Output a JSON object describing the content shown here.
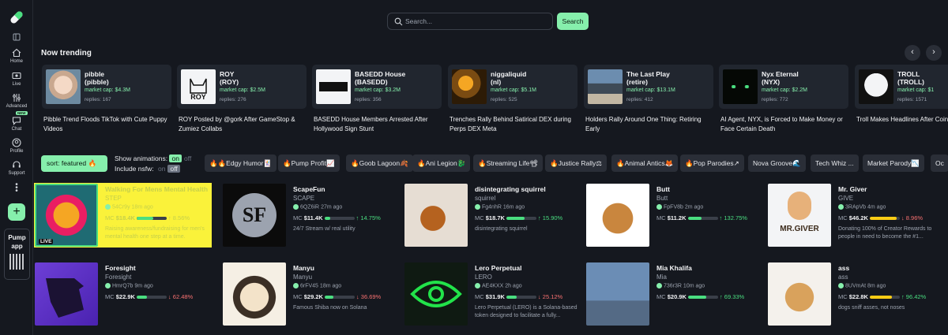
{
  "sidebar": {
    "items": [
      {
        "label": "Home",
        "icon": "home-icon"
      },
      {
        "label": "Live",
        "icon": "live-icon"
      },
      {
        "label": "Advanced",
        "icon": "advanced-icon"
      },
      {
        "label": "Chat",
        "icon": "chat-icon",
        "badge": "NEW"
      },
      {
        "label": "Profile",
        "icon": "profile-icon"
      },
      {
        "label": "Support",
        "icon": "support-icon"
      }
    ],
    "app_card": {
      "line1": "Pump",
      "line2": "app"
    }
  },
  "search": {
    "placeholder": "Search...",
    "button": "Search"
  },
  "trending": {
    "title": "Now trending",
    "cards": [
      {
        "name": "pibble",
        "ticker": "(pibble)",
        "mcap": "market cap: $4.3M",
        "replies": "replies: 167",
        "headline": "Pibble Trend Floods TikTok with Cute Puppy Videos"
      },
      {
        "name": "ROY",
        "ticker": "(ROY)",
        "mcap": "market cap: $2.5M",
        "replies": "replies: 276",
        "headline": "ROY Posted by @gork After GameStop & Zumiez Collabs"
      },
      {
        "name": "BASEDD House",
        "ticker": "(BASEDD)",
        "mcap": "market cap: $3.2M",
        "replies": "replies: 356",
        "headline": "BASEDD House Members Arrested After Hollywood Sign Stunt"
      },
      {
        "name": "niggaliquid",
        "ticker": "(nl)",
        "mcap": "market cap: $5.1M",
        "replies": "replies: 525",
        "headline": "Trenches Rally Behind Satirical DEX during Perps DEX Meta"
      },
      {
        "name": "The Last Play",
        "ticker": "(retire)",
        "mcap": "market cap: $13.1M",
        "replies": "replies: 412",
        "headline": "Holders Rally Around One Thing: Retiring Early"
      },
      {
        "name": "Nyx Eternal",
        "ticker": "(NYX)",
        "mcap": "market cap: $2.2M",
        "replies": "replies: 772",
        "headline": "AI Agent, NYX, is Forced to Make Money or Face Certain Death"
      },
      {
        "name": "TROLL",
        "ticker": "(TROLL)",
        "mcap": "market cap: $1",
        "replies": "replies: 1571",
        "headline": "Troll Makes Headlines After Coinbase Listing"
      }
    ]
  },
  "filters": {
    "sort": "sort: featured 🔥",
    "animations_label": "Show animations:",
    "nsfw_label": "Include nsfw:",
    "on": "on",
    "off": "off",
    "chips": [
      "🔥🔥Edgy Humor🃏",
      "🔥Pump Profit📈",
      "🔥Goob Lagoon🍂",
      "🔥Ani Legion🐉",
      "🔥Streaming Life📽",
      "🔥Justice Rally⚖",
      "🔥Animal Antics🦊",
      "🔥Pop Parodies↗",
      "Nova Groove🌊",
      "Tech Whiz ...",
      "Market Parody📉",
      "Oc"
    ]
  },
  "coins": [
    {
      "name": "Walking For Mens Mental Health",
      "symbol": "STEP",
      "dev": "54Cr9y",
      "age": "18m ago",
      "mc": "$18.4K",
      "change": "↑ 8.56%",
      "dir": "up",
      "progress": 0.55,
      "desc": "Raising awareness/fundraising for men's mental health one step at a time.",
      "highlight": true,
      "live": "LIVE"
    },
    {
      "name": "ScapeFun",
      "symbol": "SCAPE",
      "dev": "6QZ6iR",
      "age": "27m ago",
      "mc": "$11.4K",
      "change": "↑ 14.75%",
      "dir": "up",
      "progress": 0.2,
      "desc": "24/7 Stream w/ real utility"
    },
    {
      "name": "disintegrating squirrel",
      "symbol": "squirrel",
      "dev": "Fg4nhR",
      "age": "16m ago",
      "mc": "$18.7K",
      "change": "↑ 15.90%",
      "dir": "up",
      "progress": 0.6,
      "desc": "disintegrating squirrel"
    },
    {
      "name": "Butt",
      "symbol": "Butt",
      "dev": "FpFV8b",
      "age": "2m ago",
      "mc": "$11.2K",
      "change": "↑ 132.75%",
      "dir": "up",
      "progress": 0.45,
      "desc": ""
    },
    {
      "name": "Mr. Giver",
      "symbol": "GIVE",
      "dev": "3RApVb",
      "age": "4m ago",
      "mc": "$46.2K",
      "change": "↓ 8.96%",
      "dir": "down",
      "progress": 0.9,
      "desc": "Donating 100% of Creator Rewards to people in need to become the #1..."
    },
    {
      "name": "Foresight",
      "symbol": "Foresight",
      "dev": "HmrQ7b",
      "age": "9m ago",
      "mc": "$22.9K",
      "change": "↓ 62.48%",
      "dir": "down",
      "progress": 0.35,
      "desc": ""
    },
    {
      "name": "Manyu",
      "symbol": "Manyu",
      "dev": "6rFV45",
      "age": "18m ago",
      "mc": "$29.2K",
      "change": "↓ 36.69%",
      "dir": "down",
      "progress": 0.3,
      "desc": "Famous Shiba now on Solana"
    },
    {
      "name": "Lero Perpetual",
      "symbol": "LERO",
      "dev": "AE4KXX",
      "age": "2h ago",
      "mc": "$31.9K",
      "change": "↓ 25.12%",
      "dir": "down",
      "progress": 0.35,
      "desc": "Lero Perpetual (LERO) is a Solana-based token designed to facilitate a fully..."
    },
    {
      "name": "Mia Khalifa",
      "symbol": "Mia",
      "dev": "736r3R",
      "age": "10m ago",
      "mc": "$20.9K",
      "change": "↑ 69.33%",
      "dir": "up",
      "progress": 0.6,
      "desc": ""
    },
    {
      "name": "ass",
      "symbol": "ass",
      "dev": "8UVmAt",
      "age": "8m ago",
      "mc": "$22.8K",
      "change": "↑ 96.42%",
      "dir": "up",
      "progress": 0.75,
      "desc": "dogs sniff asses, not noses"
    }
  ],
  "colors": {
    "accent": "#86efac",
    "background": "#15181f",
    "card": "#21262f",
    "up": "#4ade80",
    "down": "#f87171",
    "highlight": "#faf23a"
  }
}
